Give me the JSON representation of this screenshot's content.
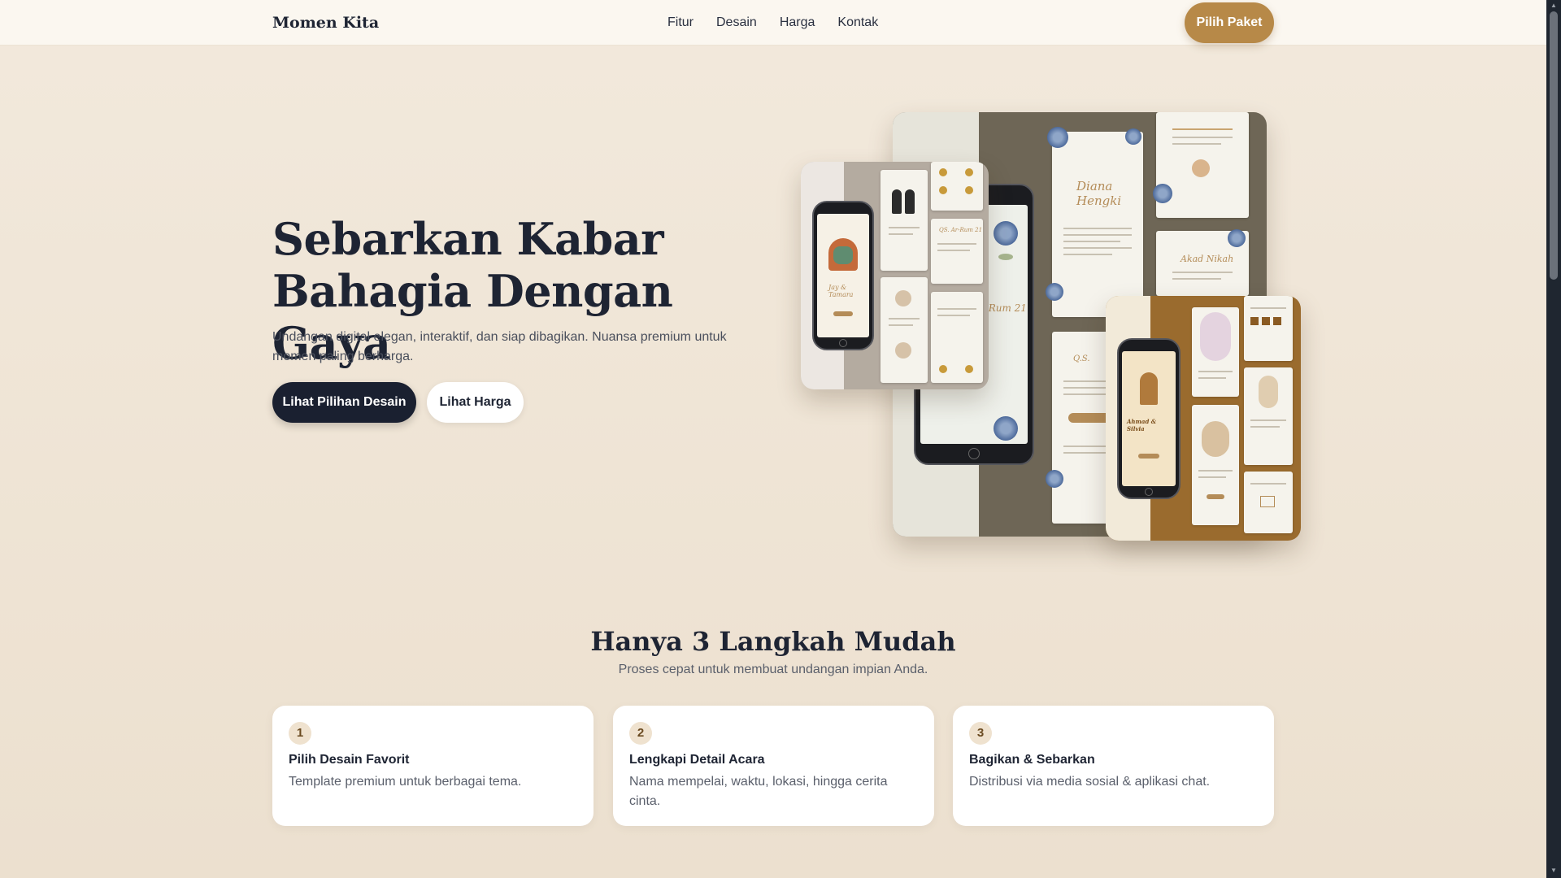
{
  "header": {
    "brand": "Momen Kita",
    "nav": [
      "Fitur",
      "Desain",
      "Harga",
      "Kontak"
    ],
    "cta_label": "Pilih Paket",
    "cta_color": "#b78948"
  },
  "hero": {
    "title": "Sebarkan Kabar Bahagia Dengan Gaya",
    "subtitle": "Undangan digital elegan, interaktif, dan siap dibagikan. Nuansa premium untuk momen paling berharga.",
    "primary_button": "Lihat Pilihan Desain",
    "secondary_button": "Lihat Harga",
    "mockup_texts": {
      "back_card_names": "Diana Hengki",
      "back_card_verse": "QS. Ar-Rum 21",
      "right_card_names": "Ahmad & Silvia"
    }
  },
  "steps": {
    "title": "Hanya 3 Langkah Mudah",
    "subtitle": "Proses cepat untuk membuat undangan impian Anda.",
    "items": [
      {
        "number": "1",
        "title": "Pilih Desain Favorit",
        "desc": "Template premium untuk berbagai tema."
      },
      {
        "number": "2",
        "title": "Lengkapi Detail Acara",
        "desc": "Nama mempelai, waktu, lokasi, hingga cerita cinta."
      },
      {
        "number": "3",
        "title": "Bagikan & Sebarkan",
        "desc": "Distribusi via media sosial & aplikasi chat."
      }
    ]
  },
  "colors": {
    "background": "#f2e9dc",
    "dark": "#1a2030",
    "accent": "#b78948"
  }
}
